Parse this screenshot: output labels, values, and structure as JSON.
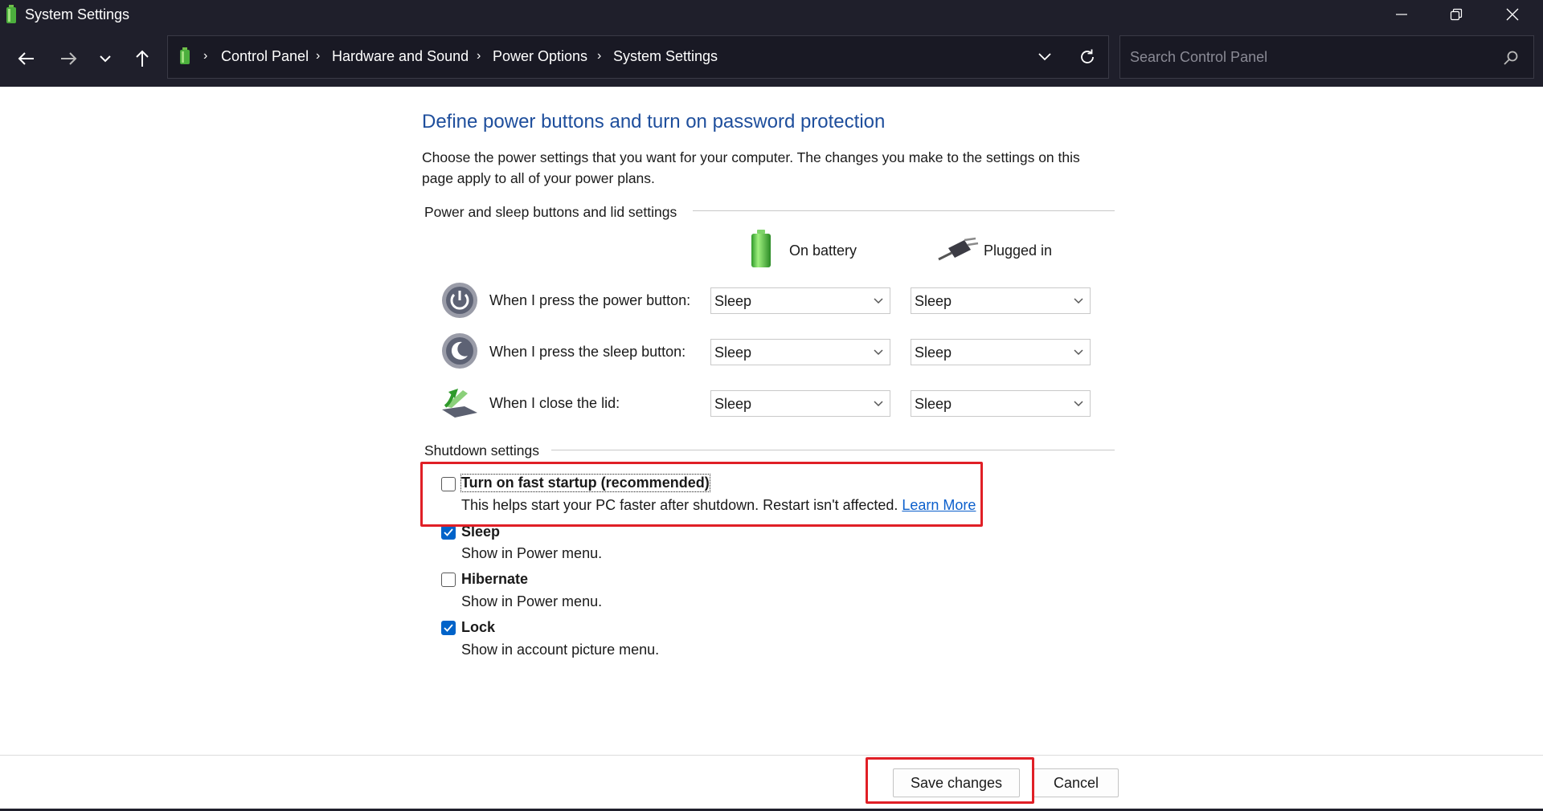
{
  "window": {
    "title": "System Settings"
  },
  "nav": {
    "breadcrumbs": [
      "Control Panel",
      "Hardware and Sound",
      "Power Options",
      "System Settings"
    ],
    "search_placeholder": "Search Control Panel"
  },
  "page": {
    "heading": "Define power buttons and turn on password protection",
    "description": "Choose the power settings that you want for your computer. The changes you make to the settings on this page apply to all of your power plans."
  },
  "power_buttons": {
    "section_label": "Power and sleep buttons and lid settings",
    "col_battery": "On battery",
    "col_plugged": "Plugged in",
    "rows": [
      {
        "label": "When I press the power button:",
        "battery": "Sleep",
        "plugged": "Sleep"
      },
      {
        "label": "When I press the sleep button:",
        "battery": "Sleep",
        "plugged": "Sleep"
      },
      {
        "label": "When I close the lid:",
        "battery": "Sleep",
        "plugged": "Sleep"
      }
    ]
  },
  "shutdown": {
    "section_label": "Shutdown settings",
    "options": [
      {
        "title": "Turn on fast startup (recommended)",
        "desc": "This helps start your PC faster after shutdown. Restart isn't affected.",
        "link": "Learn More",
        "checked": false
      },
      {
        "title": "Sleep",
        "desc": "Show in Power menu.",
        "checked": true
      },
      {
        "title": "Hibernate",
        "desc": "Show in Power menu.",
        "checked": false
      },
      {
        "title": "Lock",
        "desc": "Show in account picture menu.",
        "checked": true
      }
    ]
  },
  "footer": {
    "save_label": "Save changes",
    "cancel_label": "Cancel"
  },
  "colors": {
    "heading": "#1e4e9c",
    "checkbox_checked": "#0063c9",
    "highlight": "#e01f26",
    "chrome": "#1f1f2b"
  }
}
